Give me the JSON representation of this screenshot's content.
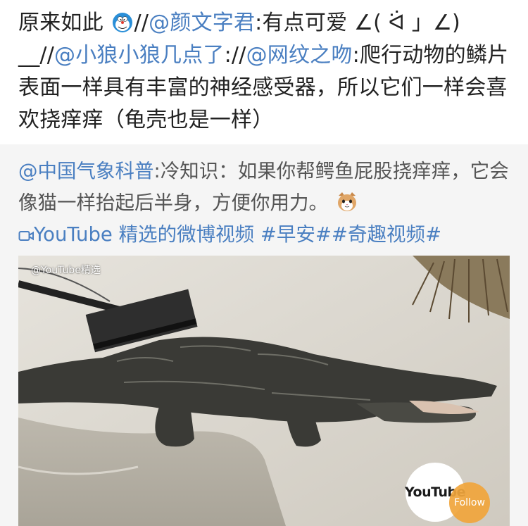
{
  "post": {
    "line1_text": "原来如此 ",
    "line1_sep": "//",
    "mention1": "@颜文字君",
    "line1_rest": ":有点可爱 ∠( ᐛ 」∠)",
    "line2_prefix": "__//",
    "mention2": "@小狼小狼几点了",
    "line2_sep": "://",
    "mention3": "@网纹之吻",
    "line2_rest": ":爬行动物的鳞片表面一样具有丰富的神经感受器，所以它们一样会喜欢挠痒痒（龟壳也是一样）",
    "emoji_icon": "doraemon-icon"
  },
  "retweet": {
    "mention": "@中国气象科普",
    "text": ":冷知识：如果你帮鳄鱼屁股挠痒痒，它会像猫一样抬起后半身，方便你用力。",
    "emoji_icon": "cat-face-icon",
    "video_icon": "video-icon",
    "video_link": "YouTube 精选的微博视频",
    "hashtag1": "#早安#",
    "hashtag2": "#奇趣视频#"
  },
  "media": {
    "watermark": "@YouTube精选",
    "logo_text": "YouTube",
    "follow_label": "Follow"
  },
  "colors": {
    "link": "#4a7fc1",
    "retweet_bg": "#f5f5f5",
    "follow_bg": "#f0a53c"
  }
}
